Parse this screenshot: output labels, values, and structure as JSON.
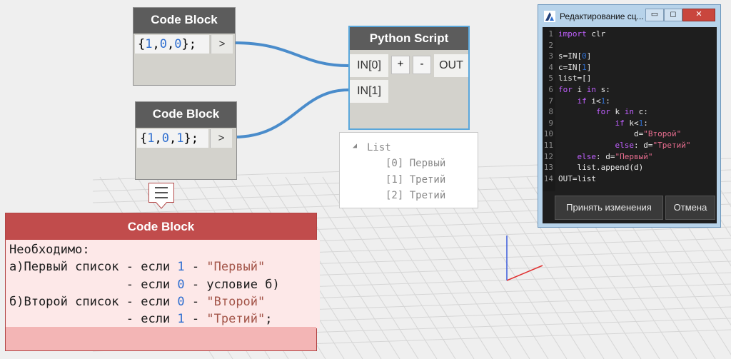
{
  "code_block_1": {
    "title": "Code Block",
    "open": "{",
    "v1": "1",
    "c1": ",",
    "v2": "0",
    "c2": ",",
    "v3": "0",
    "close": "};",
    "port": ">"
  },
  "code_block_2": {
    "title": "Code Block",
    "open": "{",
    "v1": "1",
    "c1": ",",
    "v2": "0",
    "c2": ",",
    "v3": "1",
    "close": "};",
    "port": ">"
  },
  "python_node": {
    "title": "Python Script",
    "in0": "IN[0]",
    "in1": "IN[1]",
    "add": "+",
    "remove": "-",
    "out": "OUT"
  },
  "watch": {
    "header": "List",
    "items": [
      "[0] Первый",
      "[1] Третий",
      "[2] Третий"
    ]
  },
  "note_block": {
    "title": "Code Block",
    "lines": [
      {
        "a": "Необходимо:"
      },
      {
        "a": "а)Первый список - если ",
        "n": "1",
        "b": " - ",
        "s": "\"Первый\""
      },
      {
        "a": "                - если ",
        "n": "0",
        "b": " - условие б)"
      },
      {
        "a": "б)Второй список - если ",
        "n": "0",
        "b": " - ",
        "s": "\"Второй\""
      },
      {
        "a": "                - если ",
        "n": "1",
        "b": " - ",
        "s": "\"Третий\"",
        "c": ";"
      }
    ]
  },
  "editor_window": {
    "title": "Редактирование сц...",
    "minimize": "▭",
    "maximize": "◻",
    "close": "✕",
    "line_numbers": [
      "1",
      "2",
      "3",
      "4",
      "5",
      "6",
      "7",
      "8",
      "9",
      "10",
      "11",
      "12",
      "13",
      "14"
    ],
    "code": [
      {
        "k": "import",
        "t": " clr"
      },
      {
        "t": ""
      },
      {
        "t": "s=IN[",
        "n": "0",
        "u": "]"
      },
      {
        "t": "c=IN[",
        "n": "1",
        "u": "]"
      },
      {
        "t": "list=[]"
      },
      {
        "k": "for",
        "t": " i ",
        "k2": "in",
        "u": " s:"
      },
      {
        "p": "    ",
        "k": "if",
        "t": " i<",
        "n": "1",
        "u": ":"
      },
      {
        "p": "        ",
        "k": "for",
        "t": " k ",
        "k2": "in",
        "u": " c:"
      },
      {
        "p": "            ",
        "k": "if",
        "t": " k<",
        "n": "1",
        "u": ":"
      },
      {
        "p": "                ",
        "t": "d=",
        "s": "\"Второй\""
      },
      {
        "p": "            ",
        "k": "else",
        "t": ": d=",
        "s": "\"Третий\""
      },
      {
        "p": "    ",
        "k": "else",
        "t": ": d=",
        "s": "\"Первый\""
      },
      {
        "p": "    ",
        "t": "list.append(d)"
      },
      {
        "t": "OUT=list"
      }
    ],
    "accept_label": "Принять изменения",
    "cancel_label": "Отмена"
  }
}
